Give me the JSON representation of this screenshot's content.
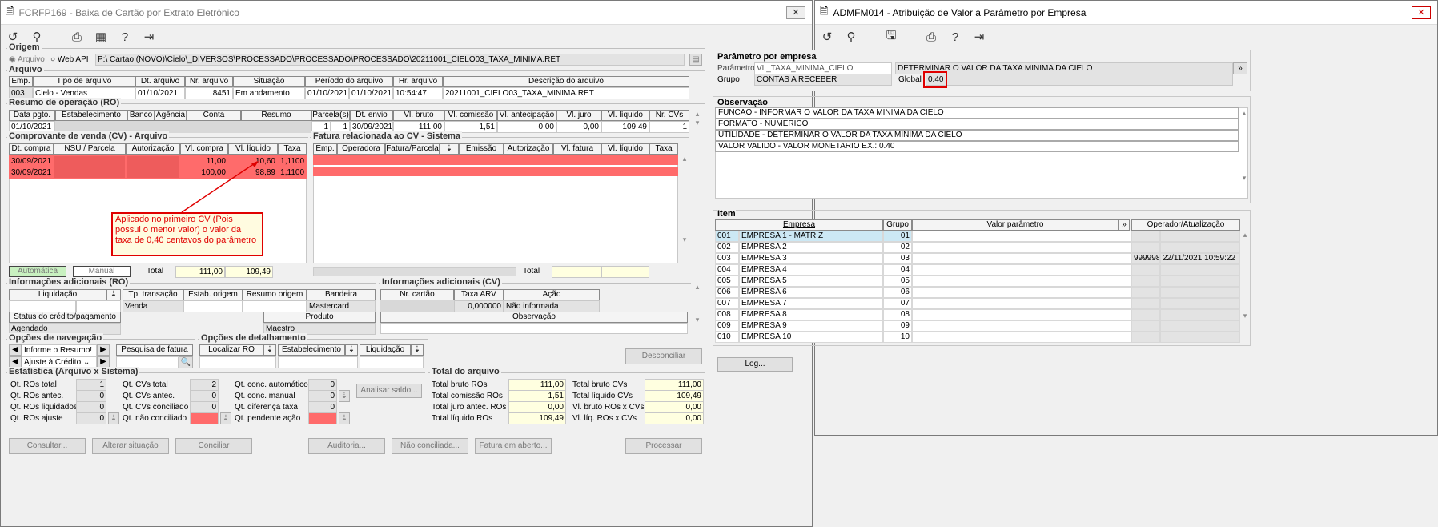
{
  "win1": {
    "title": "FCRFP169 - Baixa de Cartão por Extrato Eletrônico",
    "close": "✕"
  },
  "win2": {
    "title": "ADMFM014 - Atribuição de Valor a Parâmetro por Empresa",
    "close": "✕"
  },
  "origem": {
    "title": "Origem",
    "opt1": "Arquivo",
    "opt2": "Web API",
    "path": "P:\\              Cartao (NOVO)\\Cielo\\_DIVERSOS\\PROCESSADO\\PROCESSADO\\PROCESSADO\\20211001_CIELO03_TAXA_MINIMA.RET"
  },
  "arquivo": {
    "title": "Arquivo",
    "headers": [
      "Emp.",
      "Tipo de arquivo",
      "Dt. arquivo",
      "Nr. arquivo",
      "Situação",
      "Período do arquivo",
      "Hr. arquivo",
      "Descrição do arquivo"
    ],
    "emp": "003",
    "tipo": "Cielo - Vendas",
    "dt": "01/10/2021",
    "nr": "8451",
    "sit": "Em andamento",
    "per1": "01/10/2021",
    "per2": "01/10/2021",
    "hr": "10:54:47",
    "desc": "20211001_CIELO03_TAXA_MINIMA.RET"
  },
  "ro": {
    "title": "Resumo de operação (RO)",
    "headers": [
      "Data pgto.",
      "Estabelecimento",
      "Banco",
      "Agência",
      "Conta",
      "Resumo",
      "Parcela(s)",
      "Dt. envio",
      "Vl. bruto",
      "Vl. comissão",
      "Vl. antecipação",
      "Vl. juro",
      "Vl. líquido",
      "Nr. CVs"
    ],
    "data": "01/10/2021",
    "parc1": "1",
    "parc2": "1",
    "envio": "30/09/2021",
    "bruto": "111,00",
    "comissao": "1,51",
    "antecip": "0,00",
    "juro": "0,00",
    "liquido": "109,49",
    "ncv": "1"
  },
  "cv": {
    "title": "Comprovante de venda (CV) - Arquivo",
    "headers": [
      "Dt. compra",
      "NSU / Parcela",
      "Autorização",
      "Vl. compra",
      "Vl. líquido",
      "Taxa"
    ],
    "rows": [
      {
        "dt": "30/09/2021",
        "vc": "11,00",
        "vl": "10,60",
        "tx": "1,1100"
      },
      {
        "dt": "30/09/2021",
        "vc": "100,00",
        "vl": "98,89",
        "tx": "1,1100"
      }
    ],
    "auto": "Automática",
    "manual": "Manual",
    "total_label": "Total",
    "total1": "111,00",
    "total2": "109,49"
  },
  "fat": {
    "title": "Fatura relacionada ao CV - Sistema",
    "headers": [
      "Emp.",
      "Operadora",
      "Fatura/Parcela",
      "",
      "Emissão",
      "Autorização",
      "Vl. fatura",
      "Vl. líquido",
      "Taxa"
    ],
    "total_label": "Total"
  },
  "callout": "Aplicado no primeiro CV (Pois possui o menor valor) o valor da taxa de 0,40 centavos do parâmetro",
  "inforo": {
    "title": "Informações adicionais (RO)",
    "h_liq": "Liquidação",
    "h_tp": "Tp. transação",
    "h_estab": "Estab. origem",
    "h_resumo": "Resumo origem",
    "h_band": "Bandeira",
    "tp": "Venda",
    "band": "Mastercard",
    "h_status": "Status do crédito/pagamento",
    "h_prod": "Produto",
    "status": "Agendado",
    "prod": "Maestro"
  },
  "infocv": {
    "title": "Informações adicionais (CV)",
    "h_nr": "Nr. cartão",
    "h_taxa": "Taxa ARV",
    "h_acao": "Ação",
    "taxa": "0,000000",
    "acao": "Não informada",
    "h_obs": "Observação"
  },
  "nav": {
    "title": "Opções de navegação",
    "inf": "Informe o Resumo!",
    "ajuste": "Ajuste à Crédito",
    "pesq": "Pesquisa de fatura"
  },
  "det": {
    "title": "Opções de detalhamento",
    "loc": "Localizar RO",
    "estab": "Estabelecimento",
    "liq": "Liquidação",
    "desconciliar": "Desconciliar"
  },
  "estat": {
    "title": "Estatística (Arquivo x Sistema)",
    "c1": [
      [
        "Qt. ROs total",
        "1"
      ],
      [
        "Qt. ROs antec.",
        "0"
      ],
      [
        "Qt. ROs liquidados",
        "0"
      ],
      [
        "Qt. ROs ajuste",
        "0"
      ]
    ],
    "c2": [
      [
        "Qt. CVs total",
        "2"
      ],
      [
        "Qt. CVs antec.",
        "0"
      ],
      [
        "Qt. CVs conciliado",
        "0"
      ],
      [
        "Qt. não conciliado",
        ""
      ]
    ],
    "c3": [
      [
        "Qt. conc. automático",
        "0"
      ],
      [
        "Qt. conc. manual",
        "0"
      ],
      [
        "Qt. diferença taxa",
        "0"
      ],
      [
        "Qt. pendente ação",
        ""
      ]
    ],
    "analisar": "Analisar saldo..."
  },
  "totarq": {
    "title": "Total do arquivo",
    "l": [
      [
        "Total bruto ROs",
        "111,00"
      ],
      [
        "Total comissão ROs",
        "1,51"
      ],
      [
        "Total juro antec. ROs",
        "0,00"
      ],
      [
        "Total líquido ROs",
        "109,49"
      ]
    ],
    "r": [
      [
        "Total bruto CVs",
        "111,00"
      ],
      [
        "Total líquido CVs",
        "109,49"
      ],
      [
        "Vl. bruto ROs x CVs",
        "0,00"
      ],
      [
        "Vl. líq. ROs x CVs",
        "0,00"
      ]
    ]
  },
  "buttons": [
    "Consultar...",
    "Alterar situação",
    "Conciliar",
    "Auditoria...",
    "Não conciliada...",
    "Fatura em aberto...",
    "Processar"
  ],
  "param": {
    "title": "Parâmetro por empresa",
    "l_param": "Parâmetro",
    "param": "VL_TAXA_MINIMA_CIELO",
    "desc": "DETERMINAR O VALOR DA TAXA MINIMA DA CIELO",
    "l_grupo": "Grupo",
    "grupo": "CONTAS A RECEBER",
    "l_global": "Global",
    "global": "0.40"
  },
  "obs": {
    "title": "Observação",
    "lines": [
      "FUNCAO - INFORMAR O VALOR DA TAXA MINIMA DA CIELO",
      "FORMATO - NUMERICO",
      "UTILIDADE - DETERMINAR O VALOR DA TAXA MINIMA DA CIELO",
      "VALOR VALIDO - VALOR MONETARIO EX.: 0.40"
    ]
  },
  "item": {
    "title": "Item",
    "headers": [
      "Empresa",
      "Grupo",
      "Valor parâmetro",
      "»",
      "Operador/Atualização"
    ],
    "rows": [
      [
        "001",
        "EMPRESA 1 - MATRIZ",
        "01",
        "",
        ""
      ],
      [
        "002",
        "EMPRESA 2",
        "02",
        "",
        ""
      ],
      [
        "003",
        "EMPRESA 3",
        "03",
        "999998",
        "22/11/2021 10:59:22"
      ],
      [
        "004",
        "EMPRESA 4",
        "04",
        "",
        ""
      ],
      [
        "005",
        "EMPRESA 5",
        "05",
        "",
        ""
      ],
      [
        "006",
        "EMPRESA 6",
        "06",
        "",
        ""
      ],
      [
        "007",
        "EMPRESA 7",
        "07",
        "",
        ""
      ],
      [
        "008",
        "EMPRESA 8",
        "08",
        "",
        ""
      ],
      [
        "009",
        "EMPRESA 9",
        "09",
        "",
        ""
      ],
      [
        "010",
        "EMPRESA 10",
        "10",
        "",
        ""
      ]
    ],
    "log": "Log..."
  }
}
